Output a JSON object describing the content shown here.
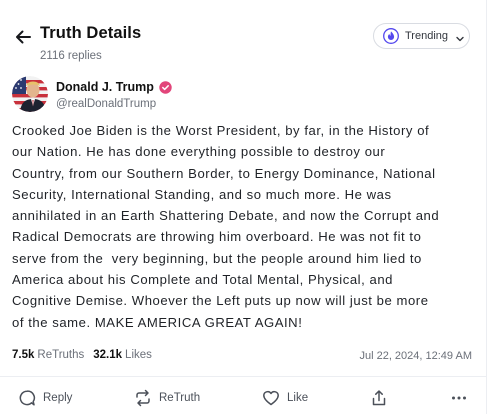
{
  "header": {
    "title": "Truth Details",
    "reply_count": "2116 replies",
    "sort": {
      "label": "Trending"
    }
  },
  "author": {
    "name": "Donald J. Trump",
    "handle": "@realDonaldTrump",
    "verified": true
  },
  "post": {
    "text": "Crooked Joe Biden is the Worst President, by far, in the History of our Nation. He has done everything possible to destroy our Country, from our Southern Border, to Energy Dominance, National Security, International Standing, and so much more. He was annihilated in an Earth Shattering Debate, and now the Corrupt and Radical Democrats are throwing him overboard. He was not fit to serve from the  very beginning, but the people around him lied to America about his Complete and Total Mental, Physical, and Cognitive Demise. Whoever the Left puts up now will just be more of the same. MAKE AMERICA GREAT AGAIN!",
    "lines": [
      "Crooked Joe Biden is the Worst President, by far, in the History of",
      "our Nation. He has done everything possible to destroy our",
      "Country, from our Southern Border, to Energy Dominance, National",
      "Security, International Standing, and so much more. He was",
      "annihilated in an Earth Shattering Debate, and now the Corrupt and",
      "Radical Democrats are throwing him overboard. He was not fit to",
      "serve from the  very beginning, but the people around him lied to",
      "America about his Complete and Total Mental, Physical, and",
      "Cognitive Demise. Whoever the Left puts up now will just be more",
      "of the same. MAKE AMERICA GREAT AGAIN!"
    ],
    "retruths_count": "7.5k",
    "retruths_label": "ReTruths",
    "likes_count": "32.1k",
    "likes_label": "Likes",
    "timestamp": "Jul 22, 2024, 12:49 AM"
  },
  "actions": {
    "reply": "Reply",
    "retruth": "ReTruth",
    "like": "Like"
  },
  "colors": {
    "accent": "#5448ee",
    "verified": "#e2457a",
    "text": "#1f2227",
    "muted": "#6b7079"
  },
  "icons": {
    "back": "arrow-left-icon",
    "sort": "trending-flame-icon",
    "sort_caret": "chevron-down-icon",
    "verified": "verified-badge-icon",
    "reply": "speech-bubble-icon",
    "retruth": "repost-arrows-icon",
    "like": "heart-icon",
    "share": "share-upload-icon",
    "more": "more-dots-icon"
  }
}
